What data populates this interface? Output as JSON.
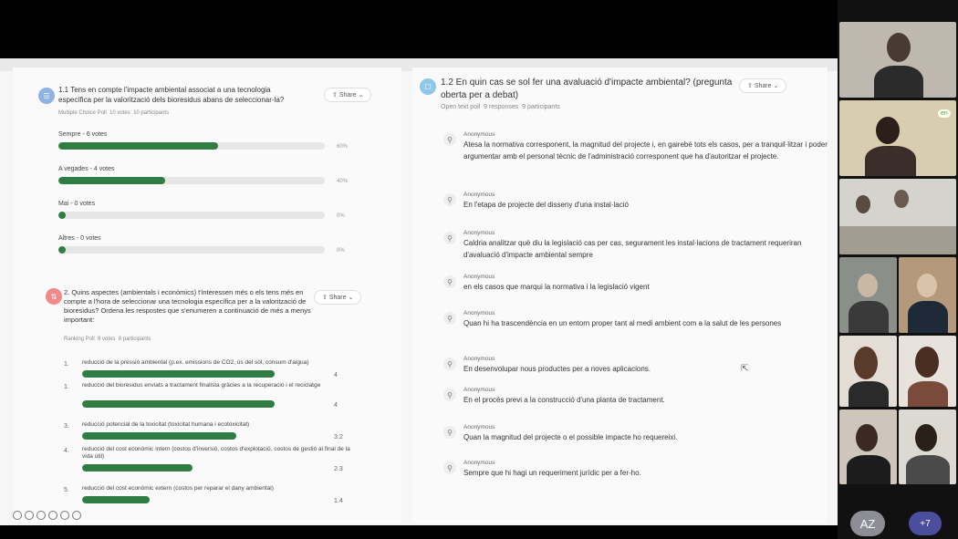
{
  "poll1": {
    "icon": "list-icon",
    "title": "1.1 Tens en compte l'impacte ambiental associat a una tecnologia específica per la valorització dels bioresidus abans de seleccionar-la?",
    "type": "Multiple Choice Poll",
    "votes": "10 votes",
    "participants": "10 participants",
    "share": "Share",
    "options": [
      {
        "label": "Sempre - 6 votes",
        "pct": "60%",
        "value": 60
      },
      {
        "label": "A vegades - 4 votes",
        "pct": "40%",
        "value": 40
      },
      {
        "label": "Mai - 0 votes",
        "pct": "0%",
        "value": 0
      },
      {
        "label": "Altres - 0 votes",
        "pct": "0%",
        "value": 0
      }
    ]
  },
  "poll2": {
    "icon": "ranking-icon",
    "title": "2. Quins aspectes (ambientals i econòmics) t'interessen més o els tens més en compte a l'hora de seleccionar una tecnologia específica per a la valorització de bioresidus? Ordena les respostes que s'enumeren a continuació de més a menys important:",
    "type": "Ranking Poll",
    "votes": "9 votes",
    "participants": "8 participants",
    "share": "Share",
    "items": [
      {
        "num": "1.",
        "label": "reducció de la pressió ambiental (p.ex. emissions de CO2, ús del sòl, consum d'aigua)",
        "val": "4",
        "value": 4
      },
      {
        "num": "1.",
        "label": "reducció del bioresidus enviats a tractament finalista gràcies a la recuperació i el reciclatge",
        "val": "4",
        "value": 4
      },
      {
        "num": "3.",
        "label": "reducció potencial de la toxicitat (toxicitat humana i ecotoxicitat)",
        "val": "3.2",
        "value": 3.2
      },
      {
        "num": "4.",
        "label": "reducció del cost econòmic intern (costos d'inversió, costos d'explotació, costos de gestió al final de la vida útil)",
        "val": "2.3",
        "value": 2.3
      },
      {
        "num": "5.",
        "label": "reducció del cost econòmic extern (costos per reparar el dany ambiental)",
        "val": "1.4",
        "value": 1.4
      }
    ]
  },
  "poll3": {
    "icon": "chat-icon",
    "title": "1.2 En quin cas se sol fer una avaluació d'impacte ambiental? (pregunta oberta per a debat)",
    "type": "Open text poll",
    "responses": "9 responses",
    "participants": "9 participants",
    "share": "Share",
    "answers": [
      {
        "who": "Anonymous",
        "text": "Atesa la normativa corresponent, la magnitud del projecte i, en gairebé tots els casos, per a tranquil·litzar i poder argumentar amb el personal tècnic de l'administració corresponent que ha d'autoritzar el projecte."
      },
      {
        "who": "Anonymous",
        "text": "En l'etapa de projecte del disseny d'una instal·lació"
      },
      {
        "who": "Anonymous",
        "text": "Caldria analitzar què diu la legislació cas per cas, segurament les instal·lacions de tractament requeriran d'avaluació d'impacte ambiental sempre"
      },
      {
        "who": "Anonymous",
        "text": "en els casos que marqui la normativa i la legislació vigent"
      },
      {
        "who": "Anonymous",
        "text": "Quan hi ha trascendència en un entorn proper tant al medi ambient com a la salut de les persones"
      },
      {
        "who": "Anonymous",
        "text": "En desenvolupar nous productes per a noves aplicacions."
      },
      {
        "who": "Anonymous",
        "text": "En el procés previ a la construcció d'una planta de tractament."
      },
      {
        "who": "Anonymous",
        "text": "Quan la magnitud del projecte o el possible impacte ho requereixi."
      },
      {
        "who": "Anonymous",
        "text": "Sempre que hi hagi un requeriment jurídic per a fer-ho."
      }
    ]
  },
  "participants": {
    "self_initials": "AZ",
    "more_count": "+7",
    "badge": "en"
  },
  "colors": {
    "bar_fill": "#2f7d43",
    "poll1_icon": "#8fb3e6",
    "poll2_icon": "#f08a8a",
    "poll3_icon": "#8ec7e8"
  }
}
